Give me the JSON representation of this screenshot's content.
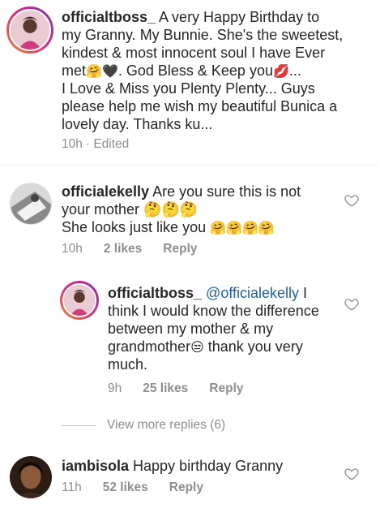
{
  "caption": {
    "username": "officialtboss_",
    "line1_rest": " A very Happy Birthday to",
    "line2": "my Granny. My Bunnie. She's the sweetest,",
    "line3": "kindest & most innocent soul I have Ever",
    "line4a": "met",
    "line4b": ". God Bless & Keep you",
    "line4c": "...",
    "line5": "I Love & Miss you Plenty Plenty... Guys",
    "line6": "please help me wish my beautiful Bunica a",
    "line7": "lovely day. Thanks ku...",
    "time": "10h",
    "edited": "· Edited"
  },
  "comments": [
    {
      "username": "officialekelly",
      "line1_rest": " Are you sure this is not",
      "line2": "your mother 🤔🤔🤔",
      "line3": "She looks just like you",
      "emoji": "🤗🤗🤗🤗",
      "time": "10h",
      "likes": "2 likes",
      "reply": "Reply"
    },
    {
      "username": "officialtboss_",
      "mention": "@officialekelly",
      "line1_rest": " I",
      "line2": "think I would know the difference",
      "line3": "between my mother & my",
      "line4a": "grandmother",
      "line4b": " thank you very",
      "line5": "much.",
      "time": "9h",
      "likes": "25 likes",
      "reply": "Reply"
    },
    {
      "username": "iambisola",
      "line1_rest": " Happy birthday Granny",
      "time": "11h",
      "likes": "52 likes",
      "reply": "Reply"
    }
  ],
  "view_more": "View more replies (6)",
  "icons": {
    "heart": "heart-outline-icon",
    "avatar_ring": "story-ring"
  },
  "colors": {
    "text": "#262626",
    "muted": "#8e8e8e",
    "mention": "#1d5fa6"
  }
}
